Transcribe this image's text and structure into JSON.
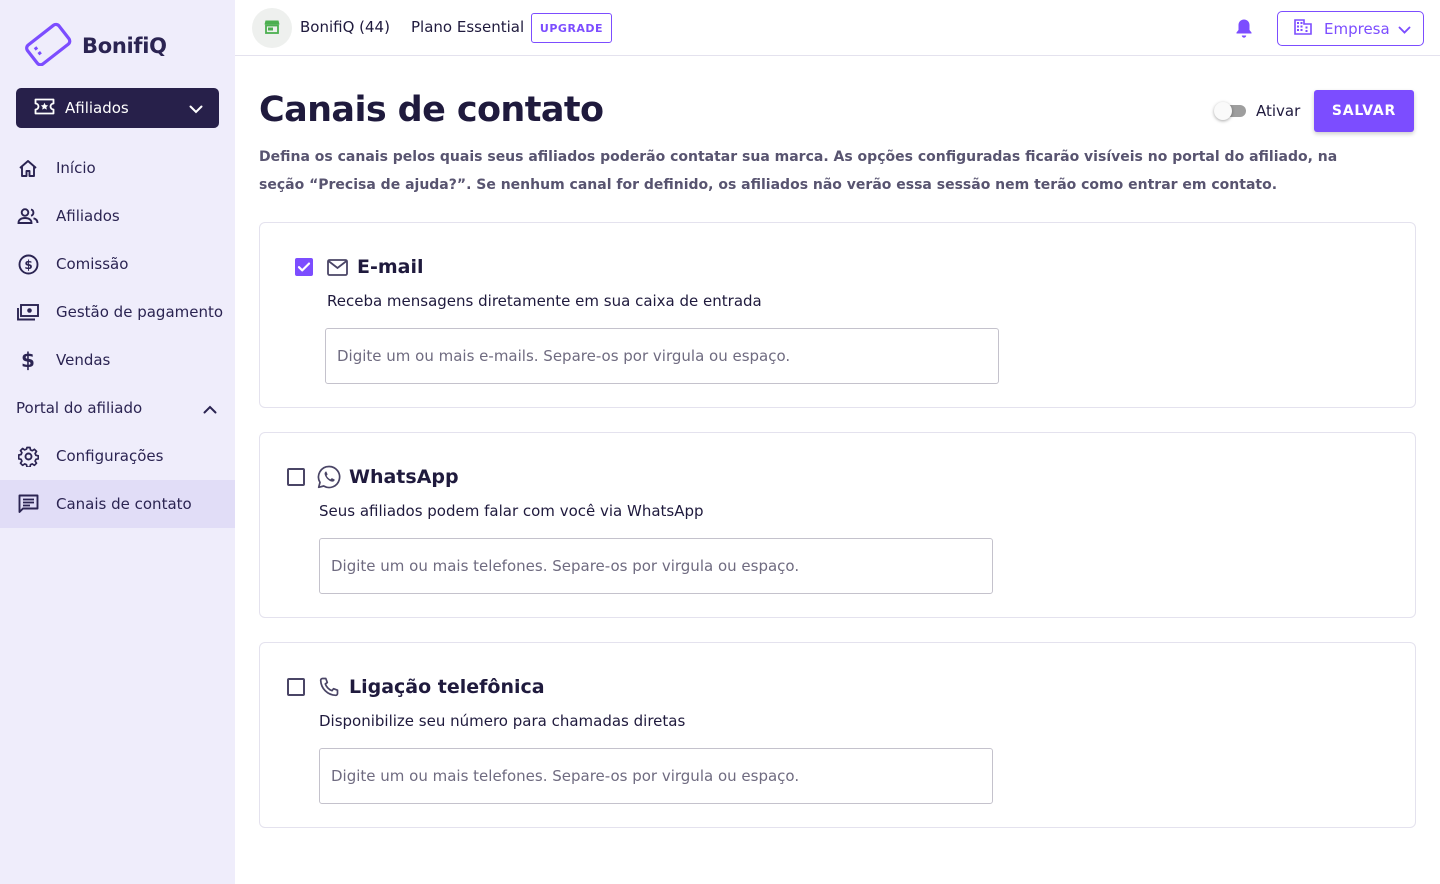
{
  "brand": {
    "name": "BonifiQ",
    "accent": "#7c4dff",
    "dark": "#27204a"
  },
  "sidebar": {
    "program_selector": {
      "label": "Afiliados",
      "icon": "ticket-icon"
    },
    "items": [
      {
        "label": "Início",
        "icon": "home-icon"
      },
      {
        "label": "Afiliados",
        "icon": "people-icon"
      },
      {
        "label": "Comissão",
        "icon": "dollar-circle-icon"
      },
      {
        "label": "Gestão de pagamento",
        "icon": "payments-icon"
      },
      {
        "label": "Vendas",
        "icon": "dollar-icon"
      }
    ],
    "section": {
      "label": "Portal do afiliado",
      "expanded": true
    },
    "section_items": [
      {
        "label": "Configurações",
        "icon": "gear-icon"
      },
      {
        "label": "Canais de contato",
        "icon": "chat-icon",
        "active": true
      }
    ]
  },
  "header": {
    "store_name": "BonifiQ (44)",
    "plan_name": "Plano Essential",
    "upgrade_label": "UPGRADE",
    "company_label": "Empresa"
  },
  "main": {
    "title": "Canais de contato",
    "toggle": {
      "label": "Ativar",
      "on": false
    },
    "save_label": "SALVAR",
    "description": "Defina os canais pelos quais seus afiliados poderão contatar sua marca. As opções configuradas ficarão visíveis no portal do afiliado, na seção “Precisa de ajuda?”. Se nenhum canal for definido, os afiliados não verão essa sessão nem terão como entrar em contato.",
    "channels": [
      {
        "title": "E-mail",
        "icon": "mail-icon",
        "checked": true,
        "description": "Receba mensagens diretamente em sua caixa de entrada",
        "value": "",
        "placeholder": "Digite um ou mais e-mails. Separe-os por virgula ou espaço."
      },
      {
        "title": "WhatsApp",
        "icon": "whatsapp-icon",
        "checked": false,
        "description": "Seus afiliados podem falar com você via WhatsApp",
        "value": "",
        "placeholder": "Digite um ou mais telefones. Separe-os por virgula ou espaço."
      },
      {
        "title": "Ligação telefônica",
        "icon": "phone-icon",
        "checked": false,
        "description": "Disponibilize seu número para chamadas diretas",
        "value": "",
        "placeholder": "Digite um ou mais telefones. Separe-os por virgula ou espaço."
      }
    ]
  }
}
